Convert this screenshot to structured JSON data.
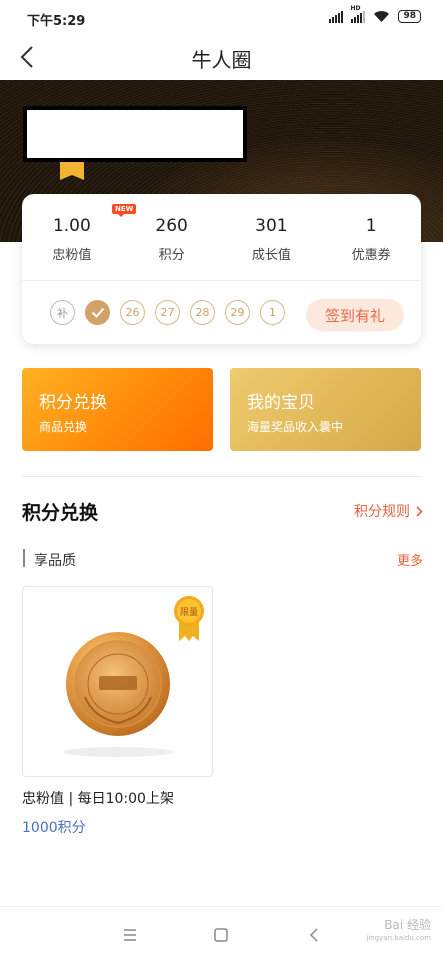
{
  "status_bar": {
    "time": "下午5:29",
    "battery": "98"
  },
  "nav": {
    "title": "牛人圈"
  },
  "stats": [
    {
      "value": "1.00",
      "label": "忠粉值",
      "badge": "NEW"
    },
    {
      "value": "260",
      "label": "积分"
    },
    {
      "value": "301",
      "label": "成长值"
    },
    {
      "value": "1",
      "label": "优惠券"
    }
  ],
  "checkin": {
    "days": [
      "补",
      "",
      "26",
      "27",
      "28",
      "29",
      "1"
    ],
    "button_label": "签到有礼"
  },
  "actions": {
    "exchange": {
      "title": "积分兑换",
      "subtitle": "商品兑换"
    },
    "treasure": {
      "title": "我的宝贝",
      "subtitle": "海量奖品收入囊中"
    }
  },
  "section": {
    "title": "积分兑换",
    "rules_label": "积分规则",
    "subsection_title": "享品质",
    "more_label": "更多"
  },
  "product": {
    "badge": "限量",
    "name": "忠粉值 | 每日10:00上架",
    "price": "1000积分"
  },
  "watermark": {
    "main": "Bai 经验",
    "sub": "jingyan.baidu.com"
  },
  "colors": {
    "accent": "#e8623a",
    "exchange_card": "#ff8a0a",
    "treasure_card": "#e0b656",
    "price": "#4a6fc0",
    "checked_day": "#d1a36a"
  }
}
